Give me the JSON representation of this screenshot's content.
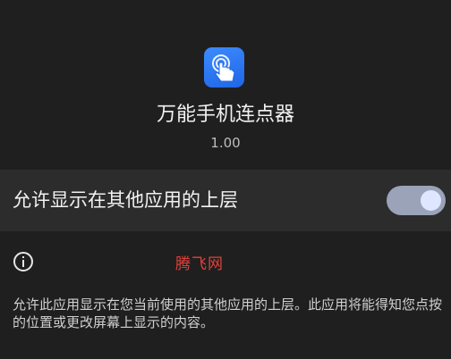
{
  "app": {
    "name": "万能手机连点器",
    "version": "1.00",
    "icon": "tap-hand-icon",
    "icon_color": "#2b7bff"
  },
  "setting": {
    "label": "允许显示在其他应用的上层",
    "enabled": true
  },
  "info": {
    "icon": "info-icon",
    "watermark": "腾飞网",
    "description": "允许此应用显示在您当前使用的其他应用的上层。此应用将能得知您点按的位置或更改屏幕上显示的内容。"
  },
  "colors": {
    "background": "#1f1f1f",
    "row_background": "#2c2c2c",
    "toggle_track": "#9aa3b8",
    "toggle_knob": "#dfe6ff",
    "watermark": "#e0413a"
  }
}
